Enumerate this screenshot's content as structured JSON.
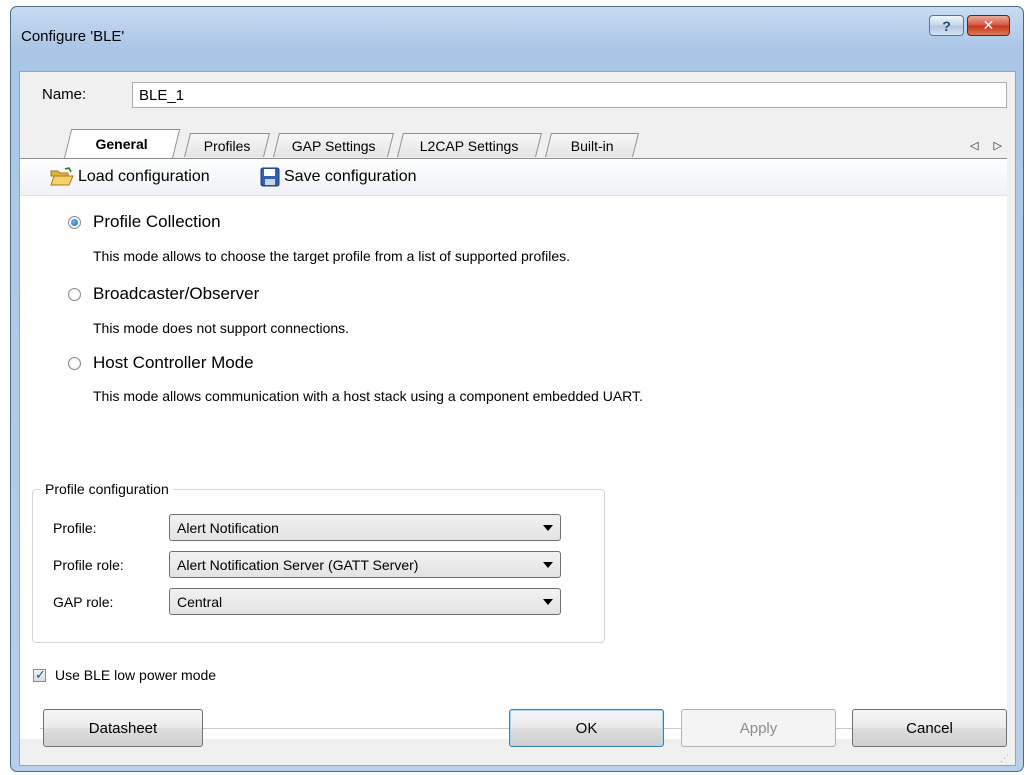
{
  "window": {
    "title": "Configure 'BLE'",
    "help_glyph": "?",
    "close_glyph": "✕"
  },
  "name_field": {
    "label": "Name:",
    "value": "BLE_1"
  },
  "tabs": [
    {
      "label": "General",
      "active": true
    },
    {
      "label": "Profiles",
      "active": false
    },
    {
      "label": "GAP Settings",
      "active": false
    },
    {
      "label": "L2CAP Settings",
      "active": false
    },
    {
      "label": "Built-in",
      "active": false
    }
  ],
  "tab_nav": {
    "arrows": "◁ ▷"
  },
  "toolbar": {
    "load_label": "Load configuration",
    "save_label": "Save configuration"
  },
  "modes": [
    {
      "label": "Profile Collection",
      "description": "This mode allows to choose the target profile from a list of supported profiles.",
      "selected": true
    },
    {
      "label": "Broadcaster/Observer",
      "description": "This mode does not support connections.",
      "selected": false
    },
    {
      "label": "Host Controller Mode",
      "description": "This mode allows communication with a host stack using a component embedded UART.",
      "selected": false
    }
  ],
  "profile_config": {
    "title": "Profile configuration",
    "profile": {
      "label": "Profile:",
      "value": "Alert Notification"
    },
    "profile_role": {
      "label": "Profile role:",
      "value": "Alert Notification Server (GATT Server)"
    },
    "gap_role": {
      "label": "GAP role:",
      "value": "Central"
    }
  },
  "low_power": {
    "label": "Use BLE low power mode",
    "checked": true,
    "tick": "✓"
  },
  "buttons": {
    "datasheet": "Datasheet",
    "ok": "OK",
    "apply": "Apply",
    "cancel": "Cancel"
  }
}
